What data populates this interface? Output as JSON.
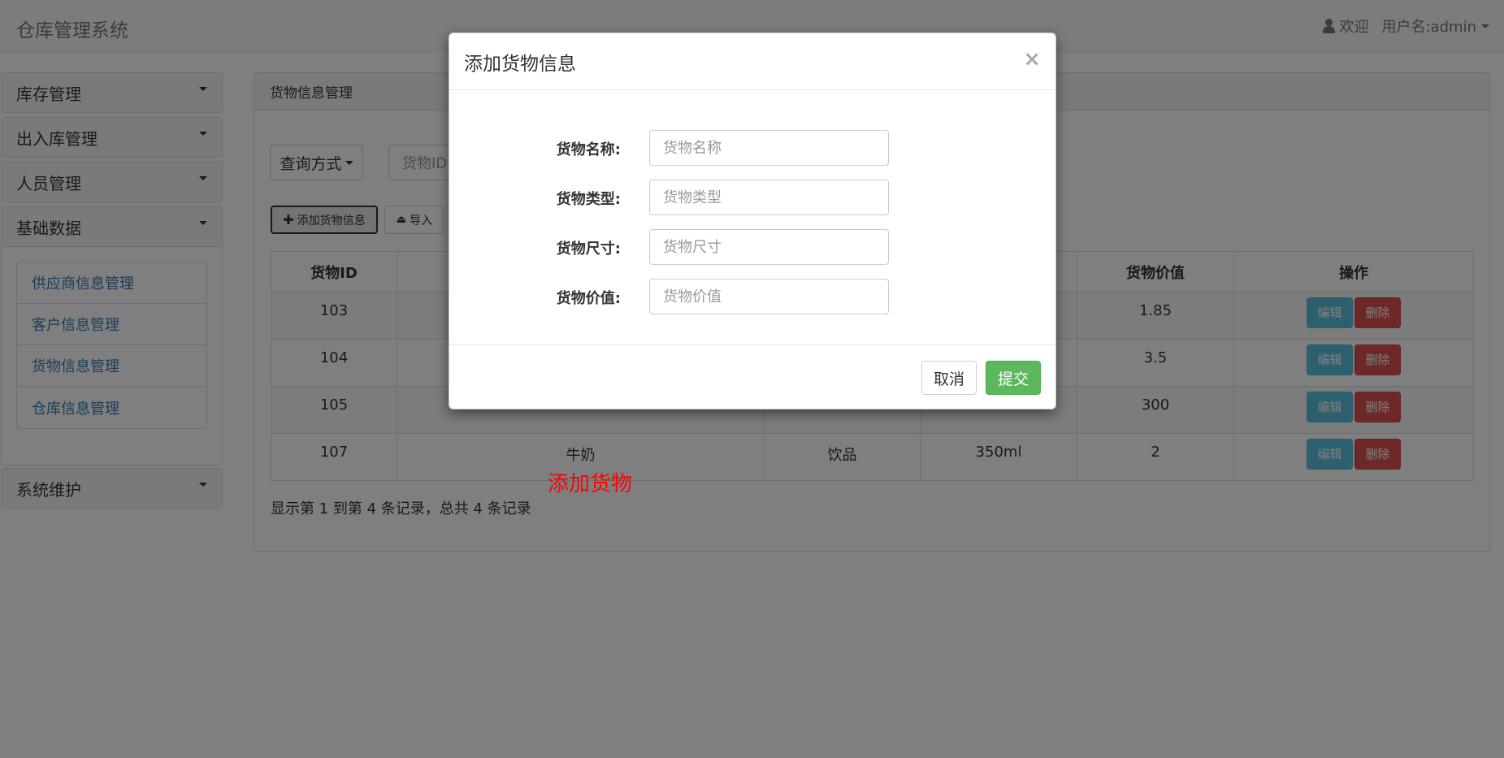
{
  "navbar": {
    "brand": "仓库管理系统",
    "welcome": "欢迎",
    "username": "用户名:admin"
  },
  "sidebar": {
    "panels": [
      {
        "label": "库存管理"
      },
      {
        "label": "出入库管理"
      },
      {
        "label": "人员管理"
      },
      {
        "label": "基础数据"
      },
      {
        "label": "系统维护"
      }
    ],
    "basic_items": [
      {
        "label": "供应商信息管理"
      },
      {
        "label": "客户信息管理"
      },
      {
        "label": "货物信息管理"
      },
      {
        "label": "仓库信息管理"
      }
    ]
  },
  "main": {
    "title": "货物信息管理",
    "query_button": "查询方式",
    "search_placeholder": "货物ID",
    "add_button": "添加货物信息",
    "import_button": "导入",
    "table": {
      "headers": [
        "货物ID",
        "",
        "",
        "",
        "货物价值",
        "操作"
      ],
      "rows": [
        [
          "103",
          "",
          "",
          "",
          "1.85"
        ],
        [
          "104",
          "",
          "",
          "",
          "3.5"
        ],
        [
          "105",
          "",
          "",
          "",
          "300"
        ],
        [
          "107",
          "牛奶",
          "饮品",
          "350ml",
          "2"
        ]
      ],
      "edit_label": "编辑",
      "delete_label": "删除"
    },
    "pager_text": "显示第 1 到第 4 条记录，总共 4 条记录"
  },
  "annotation": "添加货物",
  "modal": {
    "title": "添加货物信息",
    "close": "×",
    "fields": [
      {
        "label": "货物名称:",
        "placeholder": "货物名称",
        "value": ""
      },
      {
        "label": "货物类型:",
        "placeholder": "货物类型",
        "value": ""
      },
      {
        "label": "货物尺寸:",
        "placeholder": "货物尺寸",
        "value": ""
      },
      {
        "label": "货物价值:",
        "placeholder": "货物价值",
        "value": ""
      }
    ],
    "cancel": "取消",
    "submit": "提交"
  },
  "colors": {
    "link": "#337ab7",
    "success": "#5cb85c",
    "info": "#5bc0de",
    "danger": "#d9534f",
    "annotation": "#ff0000"
  }
}
